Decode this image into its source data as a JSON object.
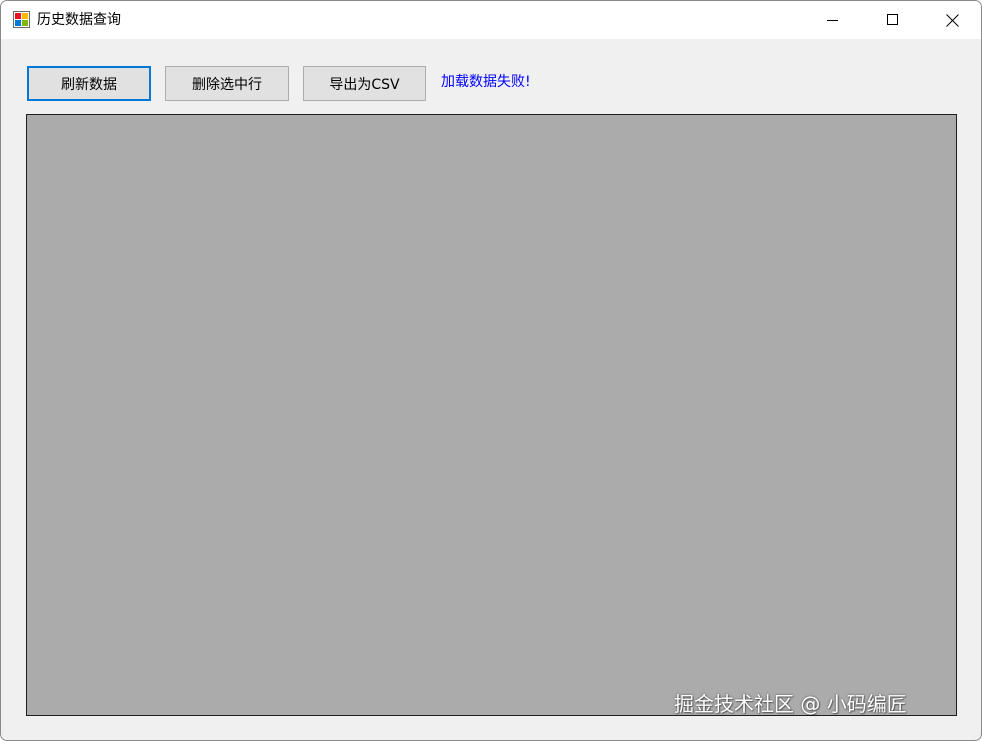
{
  "window": {
    "title": "历史数据查询",
    "icon": "windows-forms-app-icon",
    "controls": {
      "minimize_icon": "minimize-icon",
      "maximize_icon": "maximize-icon",
      "close_icon": "close-icon"
    }
  },
  "toolbar": {
    "refresh_label": "刷新数据",
    "delete_label": "删除选中行",
    "export_label": "导出为CSV",
    "status_text": "加载数据失败!"
  },
  "watermark": {
    "text": "掘金技术社区 @ 小码编匠"
  },
  "colors": {
    "window_bg": "#f0f0f0",
    "titlebar_bg": "#ffffff",
    "button_bg": "#e1e1e1",
    "focus_border": "#0078d7",
    "status_text": "#0000ff",
    "grid_bg": "#ababab"
  }
}
